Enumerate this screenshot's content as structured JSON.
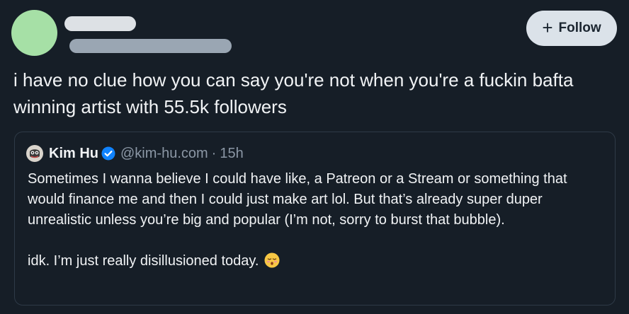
{
  "post": {
    "follow_label": "Follow",
    "text": "i have no clue how you can say you're not when you're a fuckin bafta winning artist with 55.5k followers"
  },
  "quote": {
    "author_name": "Kim Hu",
    "handle": "@kim-hu.com",
    "separator": "·",
    "time": "15h",
    "paragraph_1": "Sometimes I wanna believe I could have like, a Patreon or a Stream or something that would finance me and then I could just make art lol. But that’s already super duper unrealistic unless you’re big and popular (I’m not, sorry to burst that bubble).",
    "paragraph_2": "idk. I’m just really disillusioned today."
  },
  "colors": {
    "background": "#161e27",
    "avatar": "#a6e0a6",
    "follow_button_bg": "#dbe2e9",
    "verified": "#1083fe",
    "muted_text": "#8b97a5"
  },
  "icons": {
    "follow": "plus-icon",
    "verified": "verified-badge-icon",
    "emoji": "face-exhaling-emoji"
  }
}
